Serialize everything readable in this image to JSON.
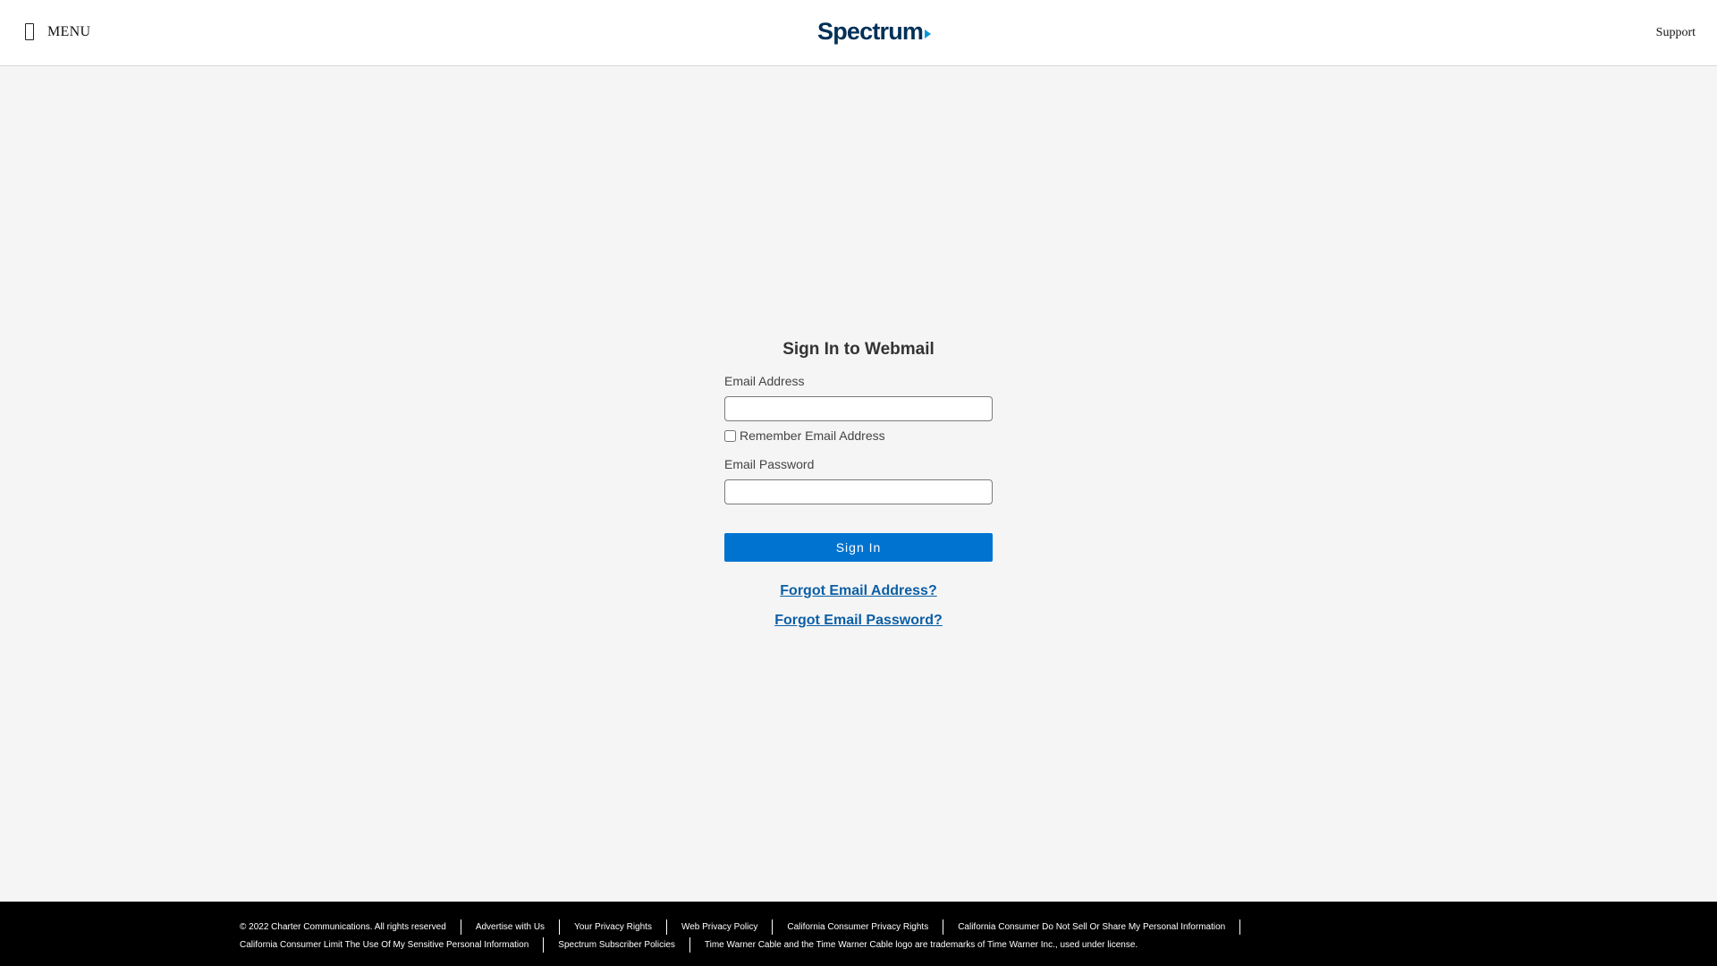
{
  "header": {
    "menu_label": "MENU",
    "logo_text": "Spectrum",
    "support_label": "Support",
    "brand_color": "#003057",
    "accent_color": "#0099d8"
  },
  "signin": {
    "title": "Sign In to Webmail",
    "email_label": "Email Address",
    "email_value": "",
    "remember_label": "Remember Email Address",
    "remember_checked": false,
    "password_label": "Email Password",
    "password_value": "",
    "button_label": "Sign In",
    "button_color": "#0073d1",
    "forgot_email": "Forgot Email Address?",
    "forgot_password": "Forgot Email Password?"
  },
  "footer": {
    "row1": [
      "© 2022 Charter Communications. All rights reserved",
      "Advertise with Us",
      "Your Privacy Rights",
      "Web Privacy Policy",
      "California Consumer Privacy Rights",
      "California Consumer Do Not Sell Or Share My Personal Information"
    ],
    "row2": [
      "California Consumer Limit The Use Of My Sensitive Personal Information",
      "Spectrum Subscriber Policies",
      "Time Warner Cable and the Time Warner Cable logo are trademarks of Time Warner Inc., used under license."
    ]
  }
}
